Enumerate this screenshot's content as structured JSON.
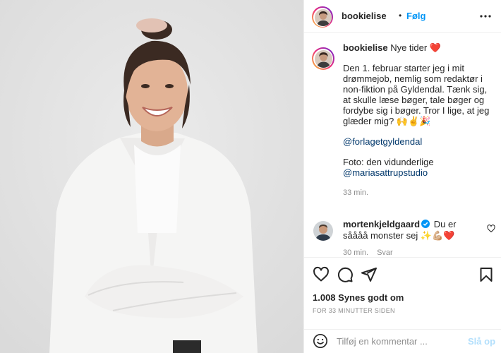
{
  "post": {
    "author": "bookielise",
    "follow_separator": "•",
    "follow_label": "Følg",
    "more_icon": "more-horizontal-icon"
  },
  "caption": {
    "username": "bookielise",
    "headline": "Nye tider ❤️",
    "paragraph": "Den 1. februar starter jeg i mit drømmejob, nemlig som redaktør i non-fiktion på Gyldendal. Tænk sig, at skulle læse bøger, tale bøger og fordybe sig i bøger. Tror I lige, at jeg glæder mig? 🙌✌️🎉",
    "mention_1": "@forlagetgyldendal",
    "photo_credit": "Foto: den vidunderlige",
    "mention_2": "@mariasattrupstudio",
    "time": "33 min."
  },
  "reply": {
    "username": "mortenkjeldgaard",
    "text": "Du er såååå monster sej ✨💪🏼❤️",
    "time": "30 min.",
    "reply_label": "Svar",
    "verified_color": "#0095f6"
  },
  "actions": {
    "like_icon": "heart-icon",
    "comment_icon": "comment-icon",
    "share_icon": "paper-plane-icon",
    "save_icon": "bookmark-icon"
  },
  "likes": "1.008 Synes godt om",
  "timestamp": "FOR 33 MINUTTER SIDEN",
  "add_comment": {
    "placeholder": "Tilføj en kommentar ...",
    "post_label": "Slå op",
    "emoji_icon": "smiley-icon"
  },
  "colors": {
    "link": "#0095f6",
    "mention": "#00376b",
    "muted": "#8e8e8e",
    "text": "#262626",
    "post_disabled": "#b2dffc"
  }
}
